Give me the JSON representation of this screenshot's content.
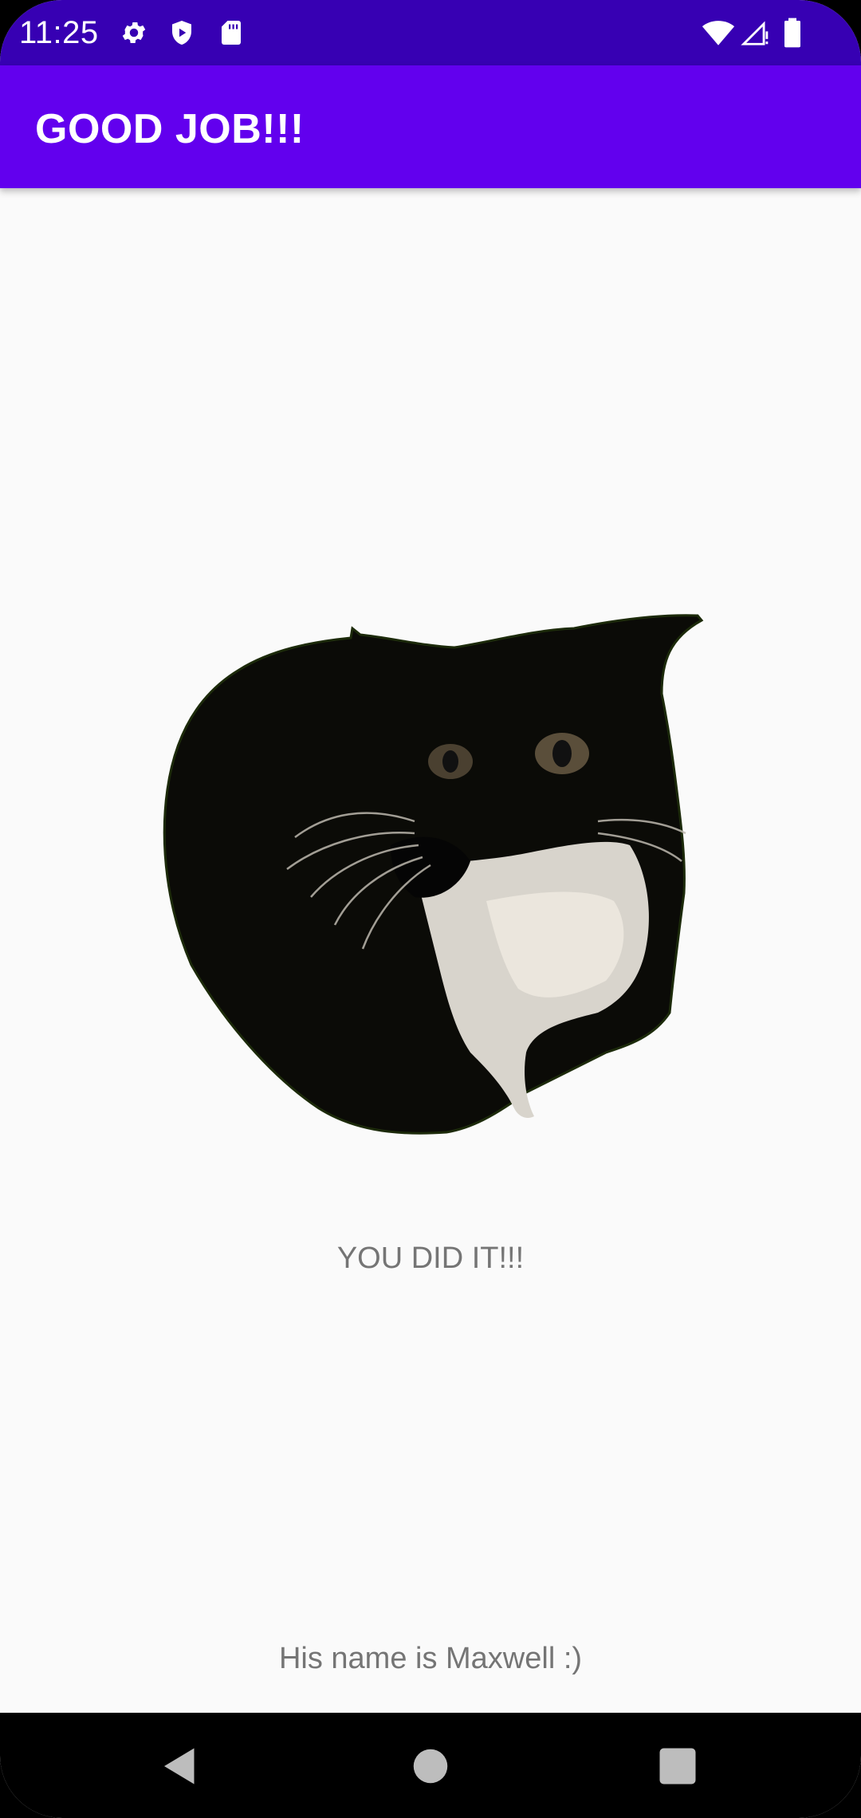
{
  "status_bar": {
    "time": "11:25",
    "left_icons": [
      "gear-icon",
      "shield-play-icon",
      "sd-card-icon"
    ],
    "right_icons": [
      "wifi-icon",
      "cellular-signal-icon",
      "battery-icon"
    ],
    "background": "#3700b3"
  },
  "app_bar": {
    "title": "GOOD JOB!!!",
    "background": "#6200ee"
  },
  "content": {
    "image": "cat-icon",
    "message": "YOU DID IT!!!",
    "caption": "His name is Maxwell :)"
  },
  "nav_bar": {
    "buttons": [
      "back-icon",
      "home-icon",
      "recents-icon"
    ]
  }
}
